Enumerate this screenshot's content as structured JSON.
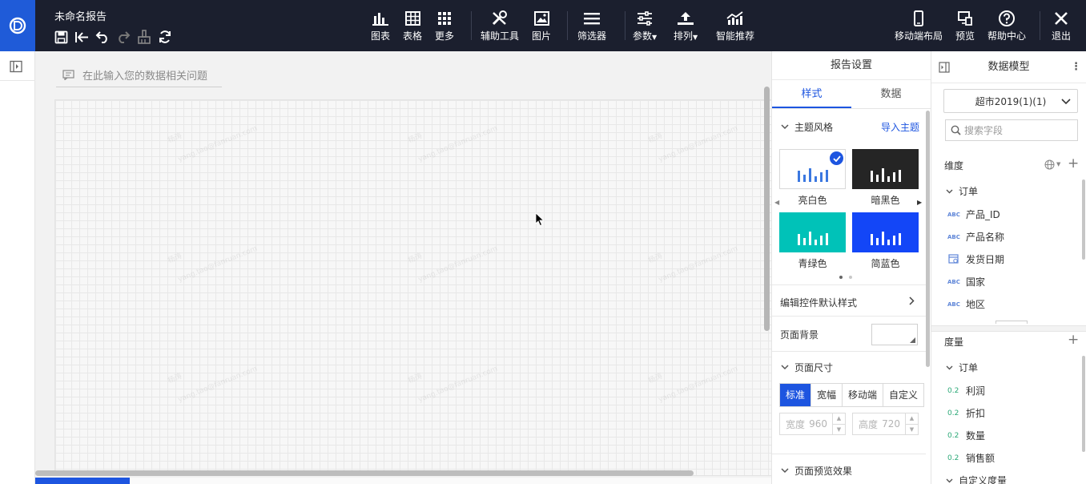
{
  "header": {
    "doc_title": "未命名报告",
    "tools": [
      {
        "label": "图表",
        "icon": "bar-chart-icon"
      },
      {
        "label": "表格",
        "icon": "table-icon"
      },
      {
        "label": "更多",
        "icon": "grid-dots-icon"
      },
      {
        "label": "辅助工具",
        "icon": "tools-icon"
      },
      {
        "label": "图片",
        "icon": "image-icon"
      },
      {
        "label": "筛选器",
        "icon": "filter-list-icon"
      },
      {
        "label": "参数",
        "icon": "sliders-icon"
      },
      {
        "label": "排列",
        "icon": "arrange-icon"
      },
      {
        "label": "智能推荐",
        "icon": "trend-chart-icon"
      }
    ],
    "right_tools": [
      {
        "label": "移动端布局",
        "icon": "mobile-icon"
      },
      {
        "label": "预览",
        "icon": "preview-icon"
      },
      {
        "label": "帮助中心",
        "icon": "help-icon"
      },
      {
        "label": "退出",
        "icon": "close-icon"
      }
    ]
  },
  "canvas": {
    "ask_placeholder": "在此输入您的数据相关问题",
    "watermark_name": "杨涛",
    "watermark_email": "yang.tao@fanruan.com"
  },
  "settings": {
    "title": "报告设置",
    "tabs": [
      "样式",
      "数据"
    ],
    "theme_section": "主题风格",
    "import_theme": "导入主题",
    "themes": [
      {
        "label": "亮白色",
        "bg": "#ffffff",
        "bar": "#3b78e0",
        "selected": true
      },
      {
        "label": "暗黑色",
        "bg": "#252525",
        "bar": "#ffffff",
        "selected": false
      },
      {
        "label": "青绿色",
        "bg": "#00c2b8",
        "bar": "#ffffff",
        "selected": false
      },
      {
        "label": "简蓝色",
        "bg": "#1346f7",
        "bar": "#ffffff",
        "selected": false
      }
    ],
    "edit_default_style": "编辑控件默认样式",
    "page_background": "页面背景",
    "page_size": "页面尺寸",
    "size_options": [
      "标准",
      "宽幅",
      "移动端",
      "自定义"
    ],
    "width_label": "宽度",
    "width_value": "960",
    "height_label": "高度",
    "height_value": "720",
    "page_preview": "页面预览效果"
  },
  "model": {
    "title": "数据模型",
    "dataset": "超市2019(1)(1)",
    "search_placeholder": "搜索字段",
    "dimension_label": "维度",
    "dimension_group": "订单",
    "dimensions": [
      {
        "type": "ABC",
        "name": "产品_ID"
      },
      {
        "type": "ABC",
        "name": "产品名称"
      },
      {
        "type": "date",
        "name": "发货日期"
      },
      {
        "type": "ABC",
        "name": "国家"
      },
      {
        "type": "ABC",
        "name": "地区"
      }
    ],
    "measure_label": "度量",
    "measure_group": "订单",
    "measures": [
      {
        "type": "0.2",
        "name": "利润"
      },
      {
        "type": "0.2",
        "name": "折扣"
      },
      {
        "type": "0.2",
        "name": "数量"
      },
      {
        "type": "0.2",
        "name": "销售额"
      }
    ],
    "custom_measure": "自定义度量"
  },
  "colors": {
    "accent": "#1d55e0",
    "topbar": "#1b1f2e"
  }
}
